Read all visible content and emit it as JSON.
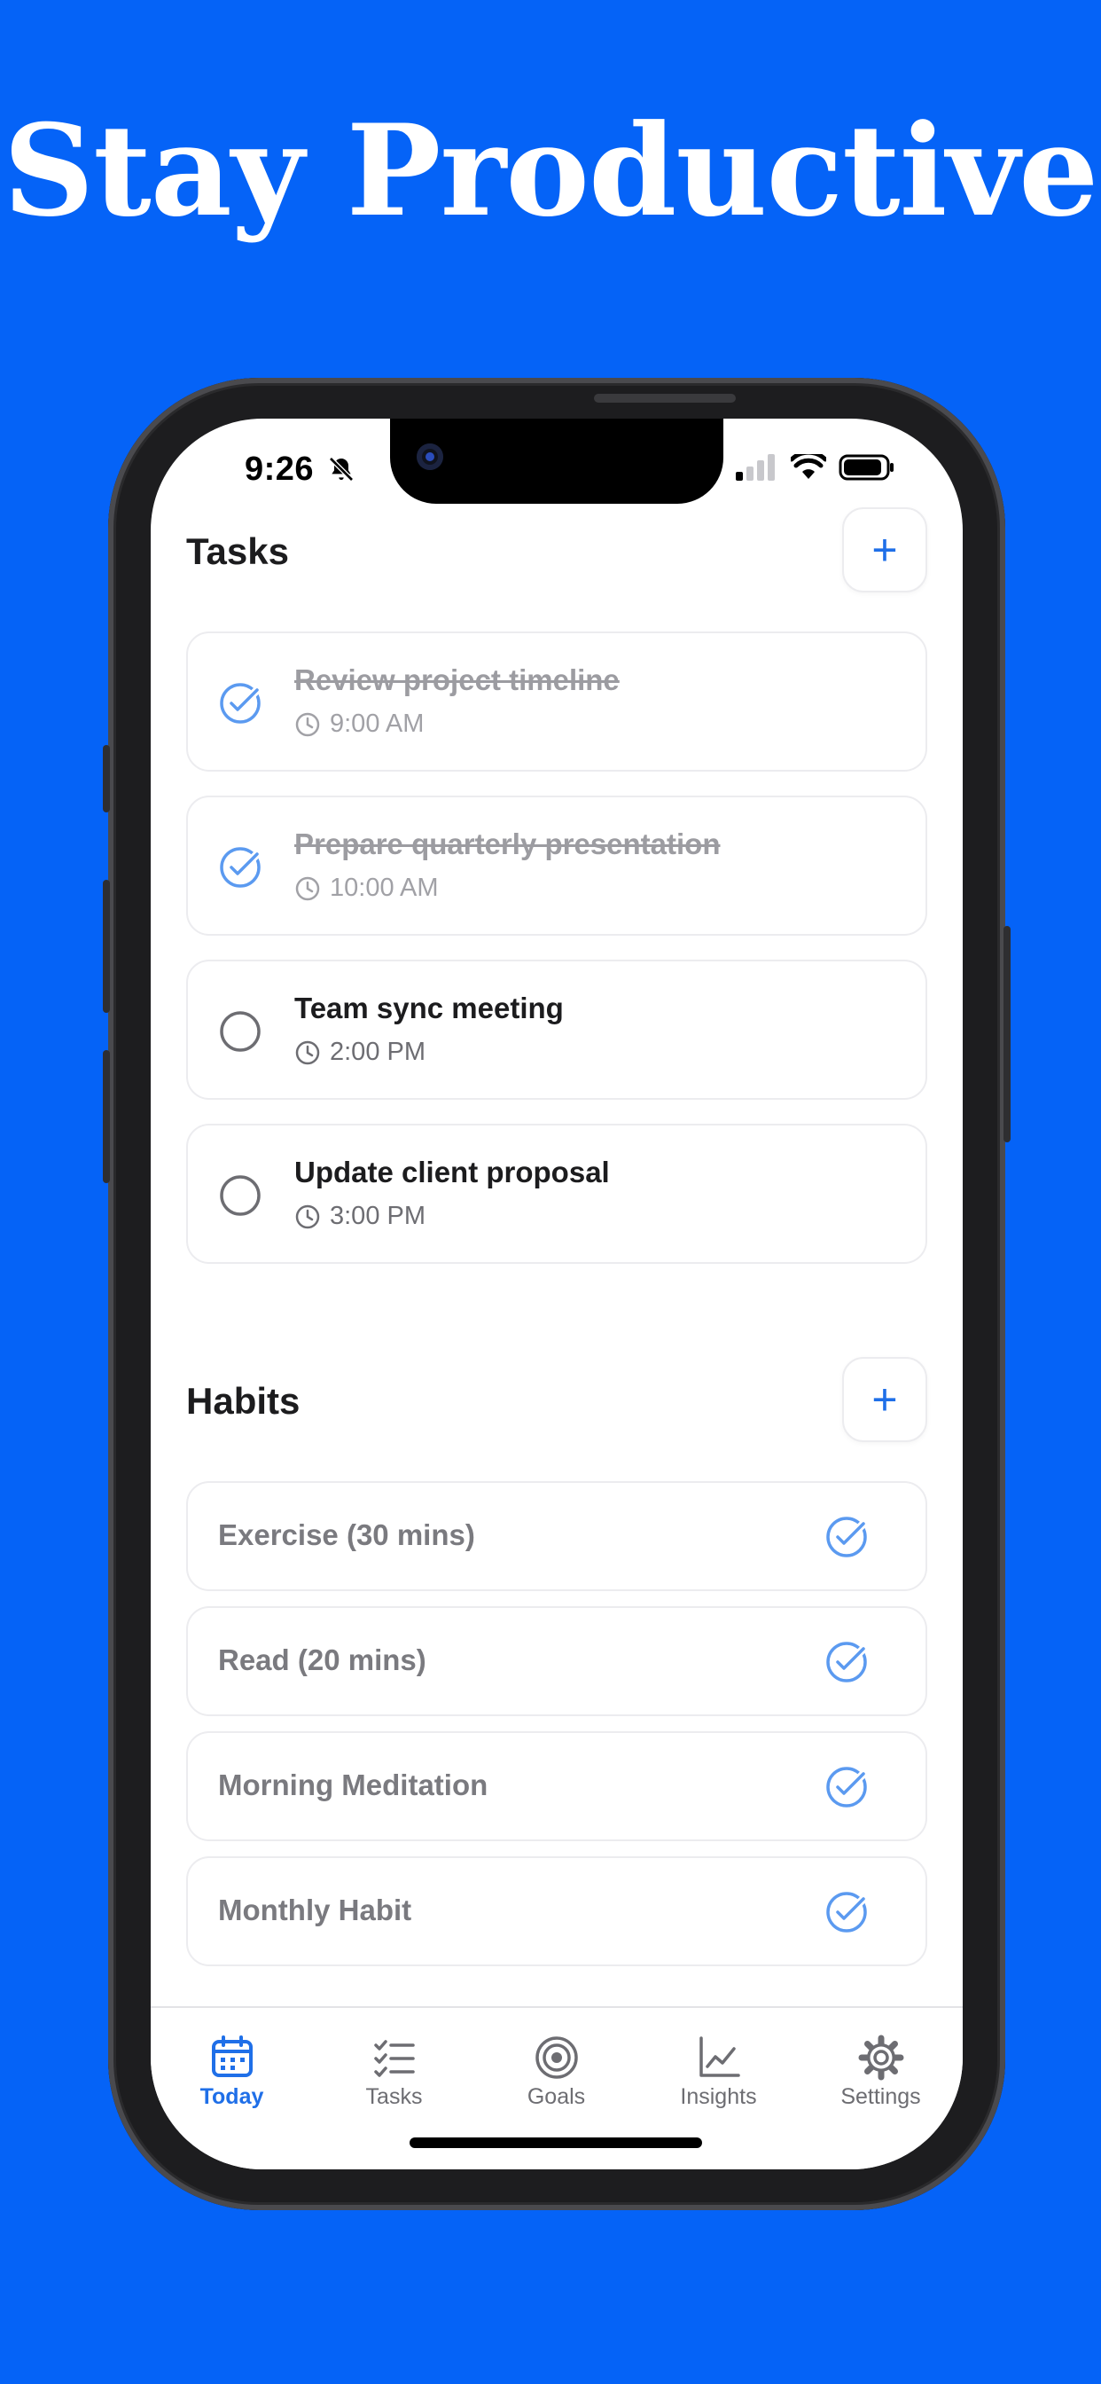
{
  "hero": {
    "title": "Stay Productive"
  },
  "status_bar": {
    "time": "9:26"
  },
  "tasks_section": {
    "title": "Tasks",
    "add_label": "+",
    "items": [
      {
        "title": "Review project timeline",
        "time": "9:00 AM",
        "completed": true
      },
      {
        "title": "Prepare quarterly presentation",
        "time": "10:00 AM",
        "completed": true
      },
      {
        "title": "Team sync meeting",
        "time": "2:00 PM",
        "completed": false
      },
      {
        "title": "Update client proposal",
        "time": "3:00 PM",
        "completed": false
      }
    ]
  },
  "habits_section": {
    "title": "Habits",
    "add_label": "+",
    "items": [
      {
        "label": "Exercise (30 mins)",
        "completed": true
      },
      {
        "label": "Read (20 mins)",
        "completed": true
      },
      {
        "label": "Morning Meditation",
        "completed": true
      },
      {
        "label": "Monthly Habit",
        "completed": true
      }
    ]
  },
  "tab_bar": {
    "tabs": [
      {
        "label": "Today",
        "icon": "calendar-icon",
        "active": true
      },
      {
        "label": "Tasks",
        "icon": "checklist-icon",
        "active": false
      },
      {
        "label": "Goals",
        "icon": "target-icon",
        "active": false
      },
      {
        "label": "Insights",
        "icon": "chart-icon",
        "active": false
      },
      {
        "label": "Settings",
        "icon": "gear-icon",
        "active": false
      }
    ]
  },
  "colors": {
    "background": "#0563f7",
    "accent": "#1f6fe8",
    "check_done": "#5b9af0"
  }
}
